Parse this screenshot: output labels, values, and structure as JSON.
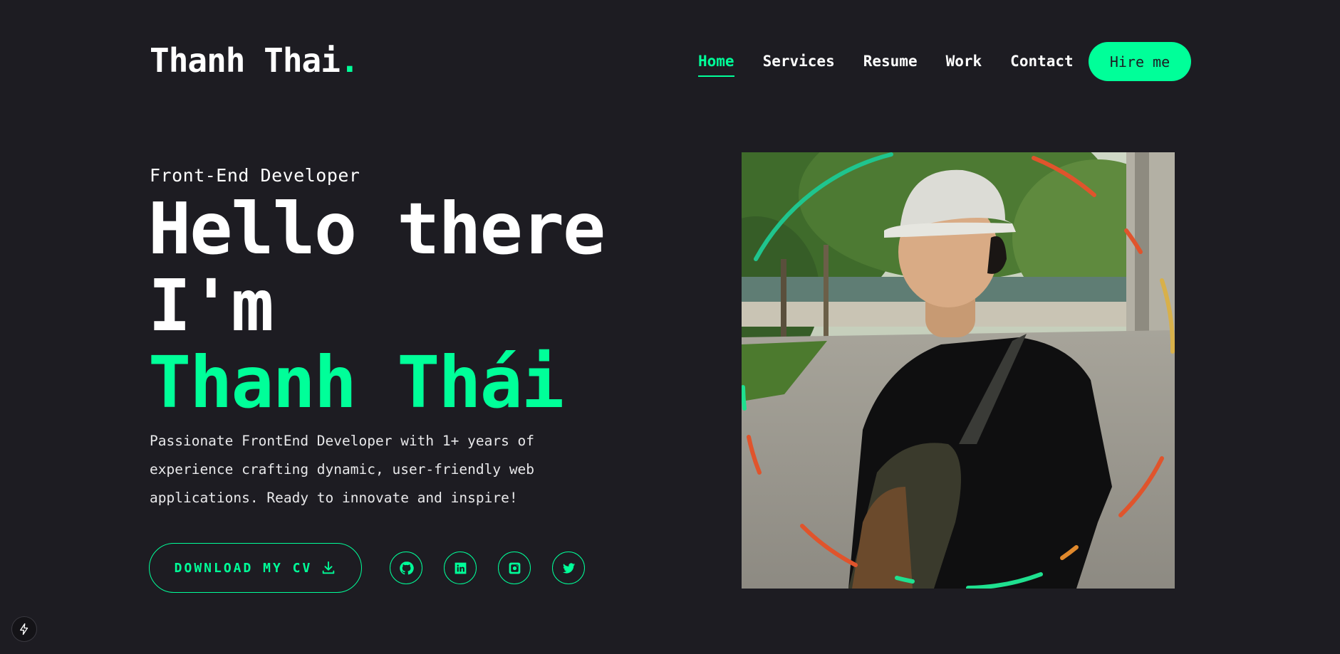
{
  "header": {
    "logo_text": "Thanh Thai",
    "logo_dot": ".",
    "nav": [
      {
        "label": "Home",
        "active": true
      },
      {
        "label": "Services",
        "active": false
      },
      {
        "label": "Resume",
        "active": false
      },
      {
        "label": "Work",
        "active": false
      },
      {
        "label": "Contact",
        "active": false
      }
    ],
    "hire_label": "Hire me"
  },
  "hero": {
    "role": "Front-End Developer",
    "line1": "Hello there",
    "line2": "I'm",
    "name": "Thanh Thái",
    "description": "Passionate FrontEnd Developer with 1+ years of experience crafting dynamic, user-friendly web applications. Ready to innovate and inspire!",
    "cv_label": "DOWNLOAD MY CV",
    "socials": [
      "github-icon",
      "linkedin-icon",
      "instagram-icon",
      "twitter-icon"
    ]
  },
  "colors": {
    "background": "#1d1c22",
    "accent": "#00ff99",
    "text": "#ffffff"
  }
}
